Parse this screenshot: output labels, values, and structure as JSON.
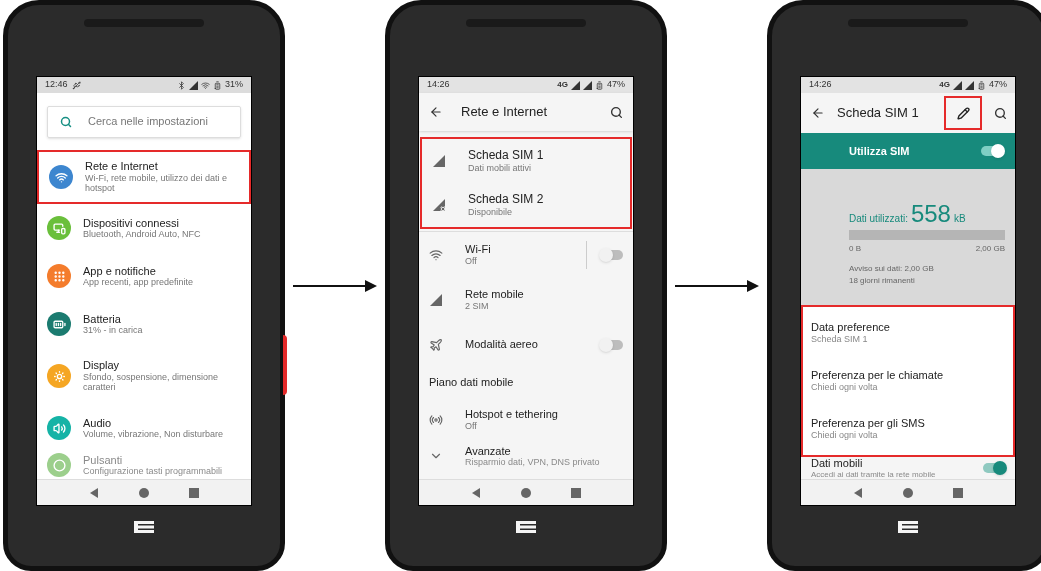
{
  "screens": [
    {
      "status": {
        "time": "12:46",
        "battery": "31%"
      },
      "search": {
        "placeholder": "Cerca nelle impostazioni"
      },
      "items": [
        {
          "title": "Rete e Internet",
          "subtitle": "Wi-Fi, rete mobile, utilizzo dei dati e hotspot",
          "color": "#3d86cf",
          "highlighted": true,
          "faded": false
        },
        {
          "title": "Dispositivi connessi",
          "subtitle": "Bluetooth, Android Auto, NFC",
          "color": "#6abf3b",
          "highlighted": false,
          "faded": false
        },
        {
          "title": "App e notifiche",
          "subtitle": "App recenti, app predefinite",
          "color": "#f47c2c",
          "highlighted": false,
          "faded": false
        },
        {
          "title": "Batteria",
          "subtitle": "31% - in carica",
          "color": "#1b7b70",
          "highlighted": false,
          "faded": false
        },
        {
          "title": "Display",
          "subtitle": "Sfondo, sospensione, dimensione caratteri",
          "color": "#f5a623",
          "highlighted": false,
          "faded": false
        },
        {
          "title": "Audio",
          "subtitle": "Volume, vibrazione, Non disturbare",
          "color": "#15b3a6",
          "highlighted": false,
          "faded": false
        },
        {
          "title": "Pulsanti",
          "subtitle": "Configurazione tasti programmabili",
          "color": "#9ccf8c",
          "highlighted": false,
          "faded": true
        }
      ]
    },
    {
      "status": {
        "time": "14:26",
        "network": "4G",
        "battery": "47%"
      },
      "toolbar": {
        "title": "Rete e Internet"
      },
      "sim_group": {
        "highlighted": true,
        "items": [
          {
            "kind": "sim",
            "title": "Scheda SIM 1",
            "subtitle": "Dati mobili attivi"
          },
          {
            "kind": "sim_off",
            "title": "Scheda SIM 2",
            "subtitle": "Disponibile"
          }
        ]
      },
      "items": [
        {
          "kind": "wifi",
          "title": "Wi-Fi",
          "subtitle": "Off",
          "on": false
        },
        {
          "kind": "signal",
          "title": "Rete mobile",
          "subtitle": "2 SIM"
        },
        {
          "kind": "plane",
          "title": "Modalità aereo",
          "on": false
        },
        {
          "kind": "header",
          "title": "Piano dati mobile"
        },
        {
          "kind": "hotspot",
          "title": "Hotspot e tethering",
          "subtitle": "Off"
        },
        {
          "kind": "expand",
          "title": "Avanzate",
          "subtitle": "Risparmio dati, VPN, DNS privato"
        }
      ]
    },
    {
      "status": {
        "time": "14:26",
        "network": "4G",
        "battery": "47%"
      },
      "toolbar": {
        "title": "Scheda SIM 1",
        "edit_highlighted": true
      },
      "use_sim": {
        "label": "Utilizza SIM",
        "on": true
      },
      "usage": {
        "label": "Dati utilizzati:",
        "amount": "558",
        "unit": "kB",
        "min": "0 B",
        "max": "2,00 GB",
        "warning": "Avviso sui dati: 2,00 GB",
        "remaining": "18 giorni rimanenti"
      },
      "pref_group": {
        "highlighted": true,
        "items": [
          {
            "title": "Data preference",
            "subtitle": "Scheda SIM 1"
          },
          {
            "title": "Preferenza per le chiamate",
            "subtitle": "Chiedi ogni volta"
          },
          {
            "title": "Preferenza per gli SMS",
            "subtitle": "Chiedi ogni volta"
          }
        ]
      },
      "mobile_data": {
        "title": "Dati mobili",
        "subtitle": "Accedi ai dati tramite la rete mobile",
        "on": true
      }
    }
  ]
}
